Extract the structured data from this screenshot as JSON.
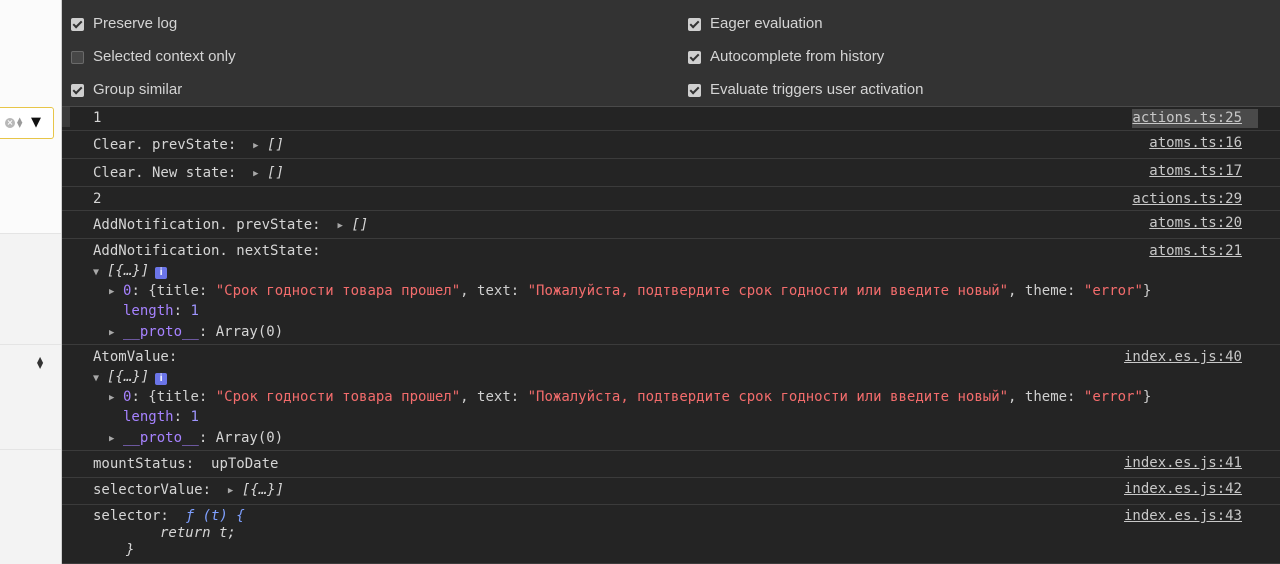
{
  "settings": {
    "left": [
      {
        "label": "Preserve log",
        "checked": true
      },
      {
        "label": "Selected context only",
        "checked": false
      },
      {
        "label": "Group similar",
        "checked": true
      }
    ],
    "right": [
      {
        "label": "Eager evaluation",
        "checked": true
      },
      {
        "label": "Autocomplete from history",
        "checked": true
      },
      {
        "label": "Evaluate triggers user activation",
        "checked": true
      }
    ]
  },
  "icons": {
    "clear": "clear-icon",
    "dropdown": "chevron-down-icon",
    "expand": "triangle-right-icon",
    "collapse": "triangle-down-icon",
    "info": "info-icon"
  },
  "colors": {
    "string": "#f36c6c",
    "number": "#9f95ff",
    "property": "#a682ff",
    "function": "#7fa0ff",
    "badge": "#6b75e8",
    "context_border": "#e7c548"
  },
  "console": {
    "m1": {
      "text": "1",
      "source": "actions.ts:25"
    },
    "m2": {
      "label": "Clear. prevState:",
      "value": "[]",
      "source": "atoms.ts:16"
    },
    "m3": {
      "label": "Clear. New state:",
      "value": "[]",
      "source": "atoms.ts:17"
    },
    "m4": {
      "text": "2",
      "source": "actions.ts:29"
    },
    "m5": {
      "label": "AddNotification. prevState:",
      "value": "[]",
      "source": "atoms.ts:20"
    },
    "m6": {
      "label": "AddNotification. nextState:",
      "source": "atoms.ts:21",
      "summary": "[{…}]",
      "badge": "i",
      "item_index": "0",
      "obj_open": "{title: ",
      "title_value": "\"Срок годности товара прошел\"",
      "text_key": ", text: ",
      "text_value": "\"Пожалуйста, подтвердите срок годности или введите новый\"",
      "theme_key": ", theme: ",
      "theme_value": "\"error\"",
      "obj_close": "}",
      "length_key": "length",
      "length_value": "1",
      "proto_key": "__proto__",
      "proto_value": "Array(0)"
    },
    "m7": {
      "label": "AtomValue:",
      "source": "index.es.js:40",
      "summary": "[{…}]",
      "badge": "i",
      "item_index": "0",
      "obj_open": "{title: ",
      "title_value": "\"Срок годности товара прошел\"",
      "text_key": ", text: ",
      "text_value": "\"Пожалуйста, подтвердите срок годности или введите новый\"",
      "theme_key": ", theme: ",
      "theme_value": "\"error\"",
      "obj_close": "}",
      "length_key": "length",
      "length_value": "1",
      "proto_key": "__proto__",
      "proto_value": "Array(0)"
    },
    "m8": {
      "label": "mountStatus:",
      "value": "upToDate",
      "source": "index.es.js:41"
    },
    "m9": {
      "label": "selectorValue:",
      "value": "[{…}]",
      "source": "index.es.js:42"
    },
    "m10": {
      "label": "selector:",
      "fn_sig": "ƒ (t) {",
      "body": "return t;",
      "close": "}",
      "source": "index.es.js:43"
    }
  }
}
